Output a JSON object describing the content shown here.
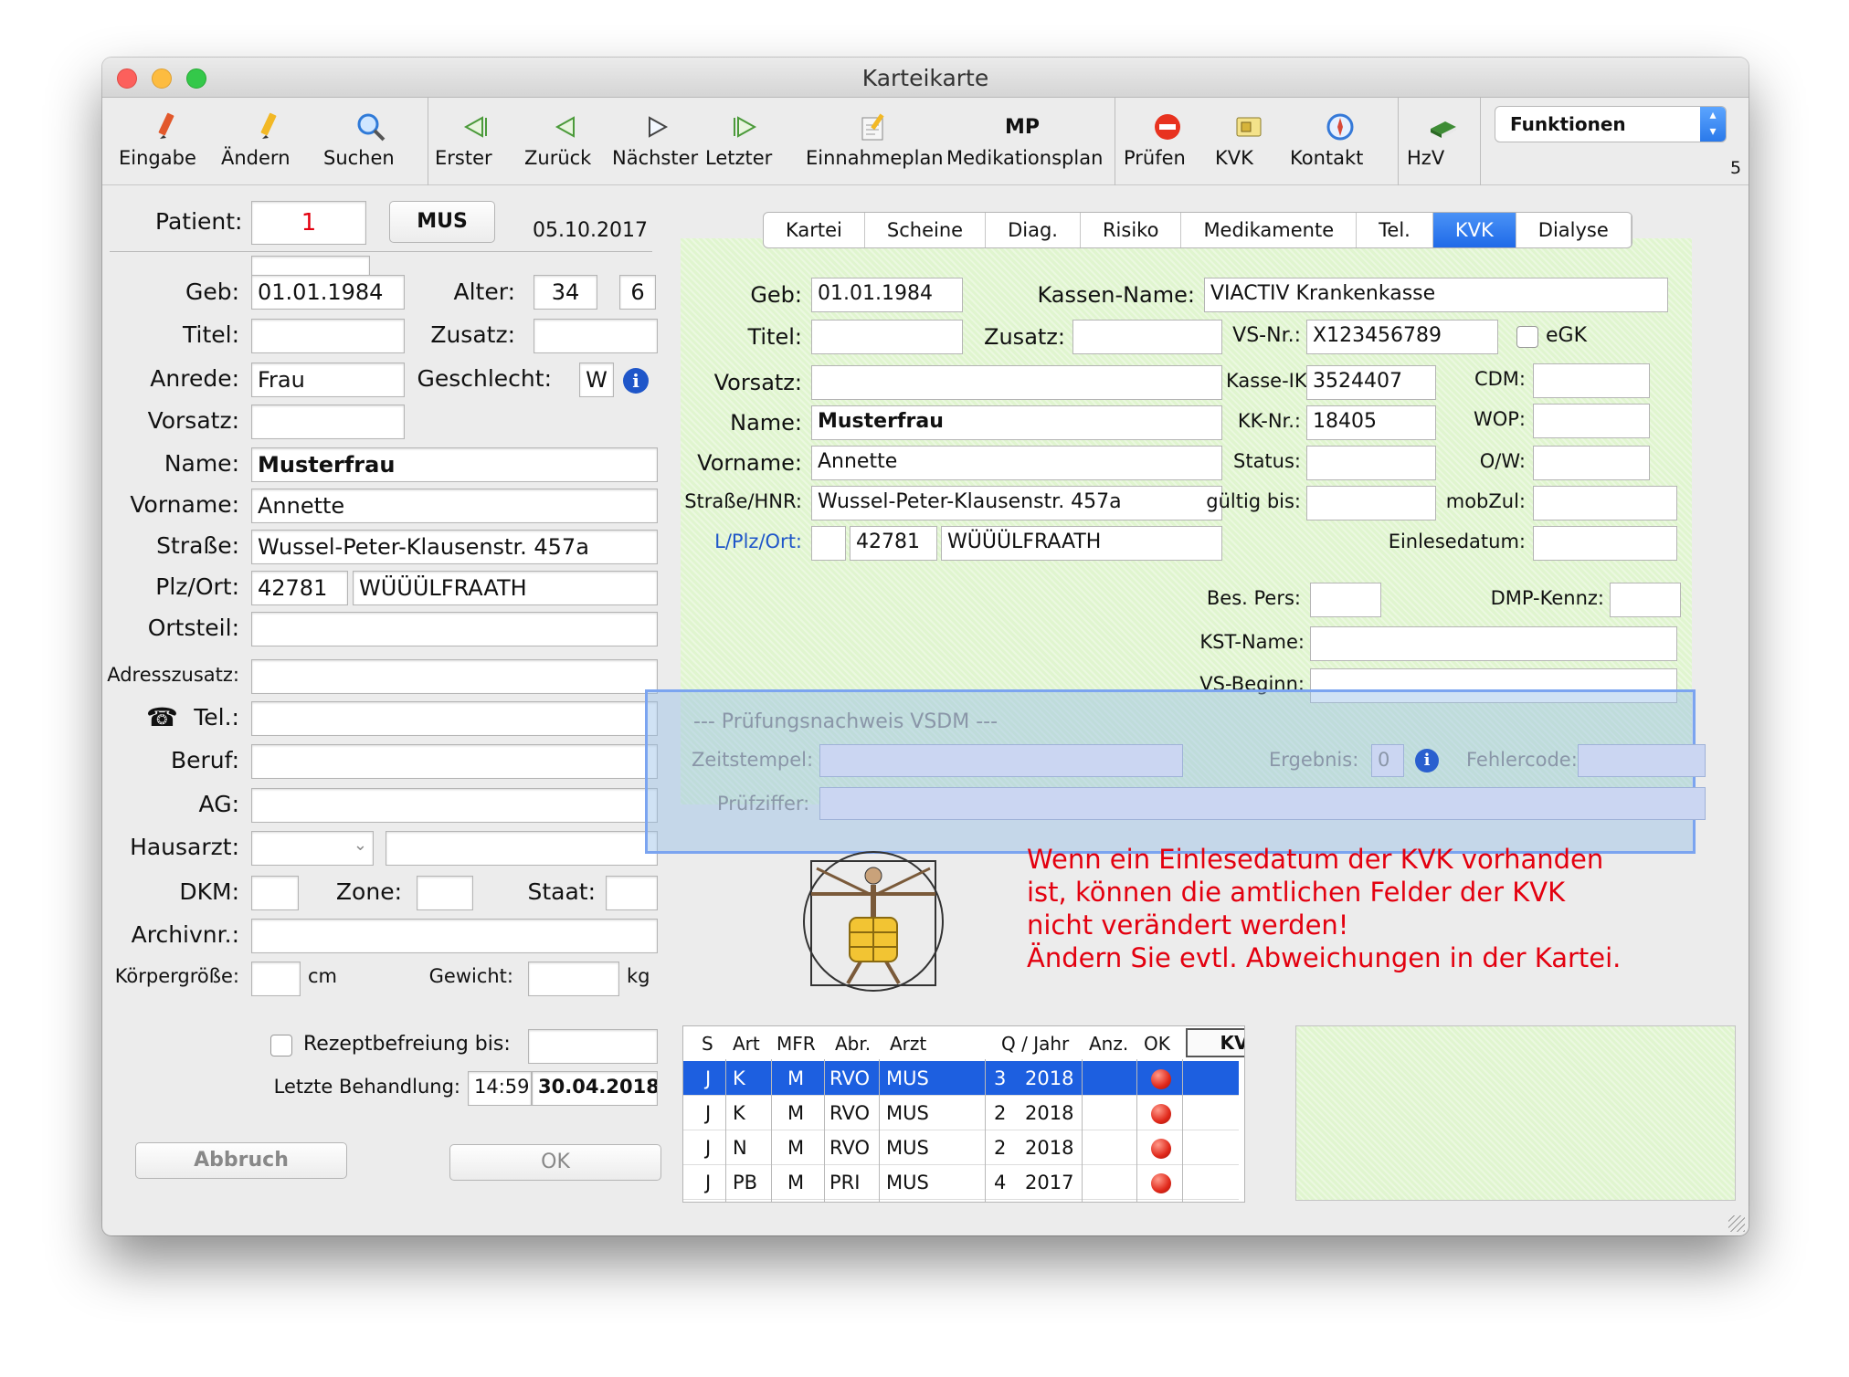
{
  "window": {
    "title": "Karteikarte"
  },
  "toolbar": {
    "buttons": [
      {
        "label": "Eingabe",
        "icon": "pencil-icon"
      },
      {
        "label": "Ändern",
        "icon": "pencil-yellow-icon"
      },
      {
        "label": "Suchen",
        "icon": "magnifier-icon"
      },
      {
        "label": "Erster",
        "icon": "first-arrow-icon"
      },
      {
        "label": "Zurück",
        "icon": "back-arrow-icon"
      },
      {
        "label": "Nächster",
        "icon": "next-arrow-icon"
      },
      {
        "label": "Letzter",
        "icon": "last-arrow-icon"
      },
      {
        "label": "Einnahmeplan",
        "icon": "document-pencil-icon"
      },
      {
        "label": "Medikationsplan",
        "icon": "mp-icon",
        "icon_text": "MP"
      },
      {
        "label": "Prüfen",
        "icon": "stop-icon"
      },
      {
        "label": "KVK",
        "icon": "card-icon"
      },
      {
        "label": "Kontakt",
        "icon": "compass-icon"
      },
      {
        "label": "HzV",
        "icon": "book-icon"
      }
    ],
    "funktionen": "Funktionen",
    "side_number": "5"
  },
  "patient": {
    "label": "Patient:",
    "number": "1",
    "code": "MUS",
    "date": "05.10.2017",
    "geb_label": "Geb:",
    "geb": "01.01.1984",
    "alter_label": "Alter:",
    "alter": "34",
    "alter_extra": "6",
    "titel_label": "Titel:",
    "titel": "",
    "zusatz_label": "Zusatz:",
    "zusatz": "",
    "anrede_label": "Anrede:",
    "anrede": "Frau",
    "geschlecht_label": "Geschlecht:",
    "geschlecht": "W",
    "vorsatz_label": "Vorsatz:",
    "vorsatz": "",
    "name_label": "Name:",
    "name": "Musterfrau",
    "vorname_label": "Vorname:",
    "vorname": "Annette",
    "strasse_label": "Straße:",
    "strasse": "Wussel-Peter-Klausenstr. 457a",
    "plzort_label": "Plz/Ort:",
    "plz": "42781",
    "ort": "WÜÜÜLFRAATH",
    "ortsteil_label": "Ortsteil:",
    "adresszusatz_label": "Adresszusatz:",
    "tel_label": "Tel.:",
    "beruf_label": "Beruf:",
    "ag_label": "AG:",
    "hausarzt_label": "Hausarzt:",
    "dkm_label": "DKM:",
    "zone_label": "Zone:",
    "staat_label": "Staat:",
    "archivnr_label": "Archivnr.:",
    "koerpergroesse_label": "Körpergröße:",
    "cm": "cm",
    "gewicht_label": "Gewicht:",
    "kg": "kg",
    "rezeptbefreiung_label": "Rezeptbefreiung bis:",
    "letzte_behandlung_label": "Letzte Behandlung:",
    "letzte_zeit": "14:59",
    "letzte_datum": "30.04.2018",
    "abbruch": "Abbruch",
    "ok": "OK"
  },
  "tabs": [
    "Kartei",
    "Scheine",
    "Diag.",
    "Risiko",
    "Medikamente",
    "Tel.",
    "KVK",
    "Dialyse"
  ],
  "active_tab": "KVK",
  "kvk": {
    "geb_label": "Geb:",
    "geb": "01.01.1984",
    "kassenname_label": "Kassen-Name:",
    "kassenname": "VIACTIV Krankenkasse",
    "titel_label": "Titel:",
    "zusatz_label": "Zusatz:",
    "vsnr_label": "VS-Nr.:",
    "vsnr": "X123456789",
    "egk_label": "eGK",
    "vorsatz_label": "Vorsatz:",
    "kasseik_label": "Kasse-IK:",
    "kasseik": "3524407",
    "cdm_label": "CDM:",
    "name_label": "Name:",
    "name": "Musterfrau",
    "kknr_label": "KK-Nr.:",
    "kknr": "18405",
    "wop_label": "WOP:",
    "vorname_label": "Vorname:",
    "vorname": "Annette",
    "status_label": "Status:",
    "ow_label": "O/W:",
    "strasse_label": "Straße/HNR:",
    "strasse": "Wussel-Peter-Klausenstr. 457a",
    "gueltig_label": "gültig bis:",
    "mobzul_label": "mobZul:",
    "lplzort_label": "L/Plz/Ort:",
    "plz": "42781",
    "ort": "WÜÜÜLFRAATH",
    "einlesedatum_label": "Einlesedatum:",
    "bespers_label": "Bes. Pers:",
    "dmp_label": "DMP-Kennz:",
    "kstname_label": "KST-Name:",
    "vsbeginn_label": "VS-Beginn:"
  },
  "vsdm": {
    "title": "--- Prüfungsnachweis VSDM ---",
    "zeitstempel_label": "Zeitstempel:",
    "ergebnis_label": "Ergebnis:",
    "ergebnis": "0",
    "fehlercode_label": "Fehlercode:",
    "pruefziffer_label": "Prüfziffer:"
  },
  "info_text": [
    "Wenn ein Einlesedatum der KVK vorhanden",
    "ist, können die amtlichen Felder der KVK",
    "nicht verändert werden!",
    "Ändern Sie evtl. Abweichungen in der Kartei."
  ],
  "table": {
    "headers": [
      "S",
      "Art",
      "MFR",
      "Abr.",
      "Arzt",
      "Q / Jahr",
      "Anz.",
      "OK"
    ],
    "kv_button": "KV",
    "rows": [
      {
        "s": "J",
        "art": "K",
        "mfr": "M",
        "abr": "RVO",
        "arzt": "MUS",
        "q": "3",
        "jahr": "2018",
        "anz": "",
        "selected": true
      },
      {
        "s": "J",
        "art": "K",
        "mfr": "M",
        "abr": "RVO",
        "arzt": "MUS",
        "q": "2",
        "jahr": "2018",
        "anz": "",
        "selected": false
      },
      {
        "s": "J",
        "art": "N",
        "mfr": "M",
        "abr": "RVO",
        "arzt": "MUS",
        "q": "2",
        "jahr": "2018",
        "anz": "",
        "selected": false
      },
      {
        "s": "J",
        "art": "PB",
        "mfr": "M",
        "abr": "PRI",
        "arzt": "MUS",
        "q": "4",
        "jahr": "2017",
        "anz": "",
        "selected": false
      }
    ]
  },
  "colors": {
    "accent": "#1f6ae8",
    "warning": "#e3000f",
    "kvk_panel": "#e0f5cf",
    "vsdm_overlay": "#96bee6"
  }
}
